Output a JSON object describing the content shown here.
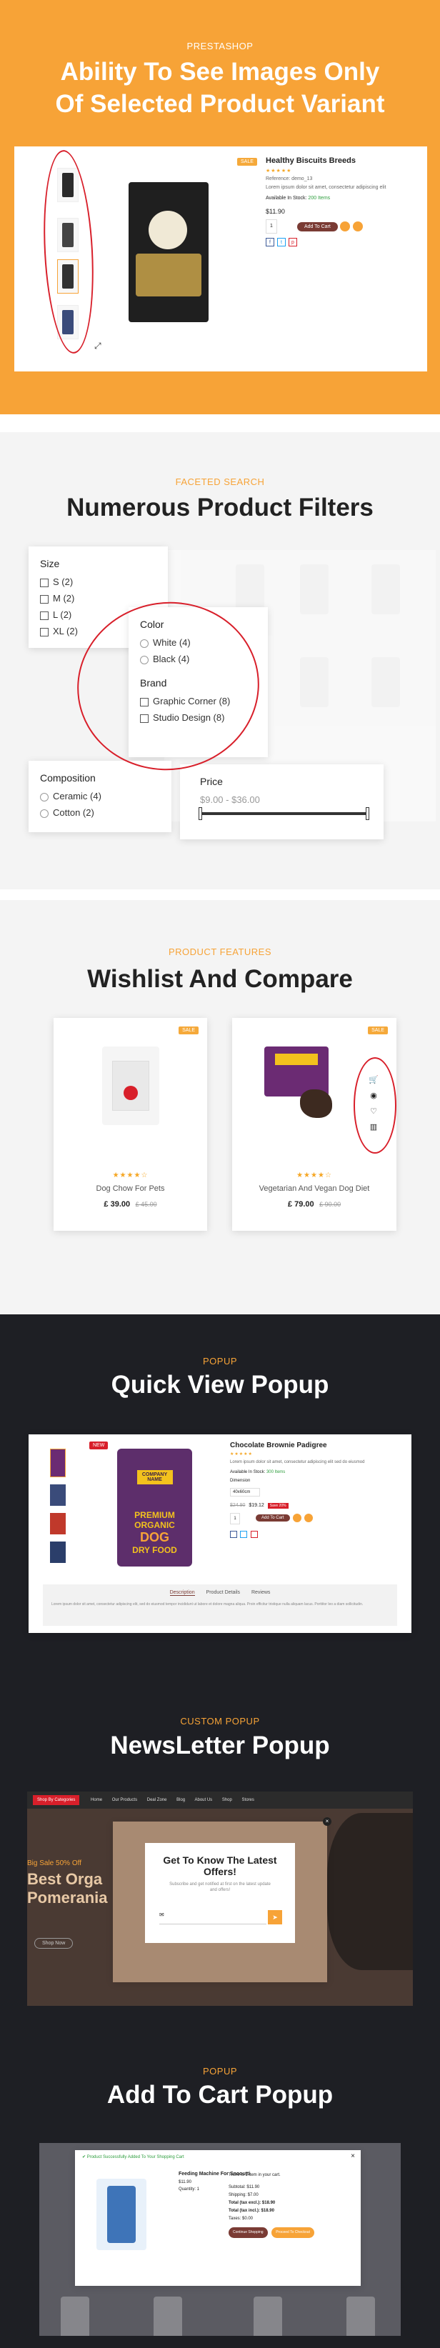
{
  "colors": {
    "orange": "#f7a337",
    "red_circle": "#d81f2a",
    "brown": "#7a3b34",
    "green": "#2e9e3e",
    "dark": "#1e1f24",
    "light_gray": "#f2f2f2"
  },
  "s1": {
    "kicker": "PRESTASHOP",
    "title_line1": "Ability To See Images Only",
    "title_line2": "Of Selected Product Variant",
    "product_name": "Healthy Biscuits Breeds",
    "reference": "Reference: demo_13",
    "desc": "Lorem ipsum dolor sit amet, consectetur adipiscing elit",
    "stock_label": "Available In Stock:",
    "stock_value": "200 Items",
    "price": "$11.90",
    "qty": "1",
    "add_to_cart": "Add To Cart",
    "badge": "SALE",
    "social": [
      "f",
      "t",
      "p"
    ],
    "expand_icon": "⤢"
  },
  "s2": {
    "kicker": "FACETED SEARCH",
    "title": "Numerous Product Filters",
    "size_heading": "Size",
    "sizes": [
      "S (2)",
      "M (2)",
      "L (2)",
      "XL (2)"
    ],
    "color_heading": "Color",
    "colors": [
      "White (4)",
      "Black (4)"
    ],
    "brand_heading": "Brand",
    "brands": [
      "Graphic Corner (8)",
      "Studio Design (8)"
    ],
    "composition_heading": "Composition",
    "compositions": [
      "Ceramic (4)",
      "Cotton (2)"
    ],
    "price_heading": "Price",
    "price_range": "$9.00 - $36.00"
  },
  "s3": {
    "kicker": "PRODUCT FEATURES",
    "title": "Wishlist And Compare",
    "products": [
      {
        "name": "Dog Chow For Pets",
        "price": "£ 39.00",
        "old_price": "£ 45.00",
        "badge": "SALE",
        "stars": "★★★★☆"
      },
      {
        "name": "Vegetarian And Vegan Dog Diet",
        "price": "£ 79.00",
        "old_price": "£ 90.00",
        "badge": "SALE",
        "stars": "★★★★☆"
      }
    ],
    "actions": [
      "cart-icon",
      "eye-icon",
      "heart-icon",
      "compare-icon"
    ]
  },
  "s4": {
    "kicker": "POPUP",
    "title": "Quick View Popup",
    "product_name": "Chocolate Brownie Padigree",
    "desc": "Lorem ipsum dolor sit amet, consectetur adipiscing elit sed do eiusmod",
    "stock_label": "Available In Stock:",
    "stock_value": "300 Items",
    "dimension_label": "Dimension",
    "dimension_value": "40x60cm",
    "price": "$19.12",
    "old_price": "$24.90",
    "discount": "Save 20%",
    "qty": "1",
    "add_to_cart": "Add To Cart",
    "badge": "NEW",
    "tabs": [
      "Description",
      "Product Details",
      "Reviews"
    ],
    "tab_text": "Lorem ipsum dolor sit amet, consectetur adipiscing elit, sed do eiusmod tempor incididunt ut labore et dolore magna aliqua. Proin efficitur tristique nulla aliquam lacus. Porttitor leo a diam sollicitudin.",
    "bag_text1": "PREMIUM",
    "bag_text2": "ORGANIC",
    "bag_text3": "DOG",
    "bag_text4": "DRY FOOD",
    "bag_brand": "COMPANY NAME"
  },
  "s5": {
    "kicker": "CUSTOM POPUP",
    "title": "NewsLetter Popup",
    "popup_title_line1": "Get To Know The Latest",
    "popup_title_line2": "Offers!",
    "popup_sub": "Subscribe and get notified at first on the latest update and offers!",
    "bg_sale": "Big Sale 50% Off",
    "bg_title_line1": "Best Orga",
    "bg_title_line2": "Pomerania",
    "bg_btn": "Shop Now",
    "nav": [
      "Shop By Categories",
      "Home",
      "Our Products",
      "Deal Zone",
      "Blog",
      "About Us",
      "Shop",
      "Stores"
    ]
  },
  "s6": {
    "kicker": "POPUP",
    "title": "Add To Cart Popup",
    "success": "Product Successfully Added To Your Shopping Cart",
    "product_name": "Feeding Machine For Snooutti",
    "product_price": "$11.90",
    "qty": "Quantity: 1",
    "right_head": "There is 1 item in your cart.",
    "subtotal": "Subtotal: $11.90",
    "shipping": "Shipping: $7.00",
    "total_excl": "Total (tax excl.): $18.90",
    "total_incl": "Total (tax incl.): $18.90",
    "taxes": "Taxes: $0.00",
    "btn_continue": "Continue Shopping",
    "btn_checkout": "Proceed To Checkout"
  }
}
